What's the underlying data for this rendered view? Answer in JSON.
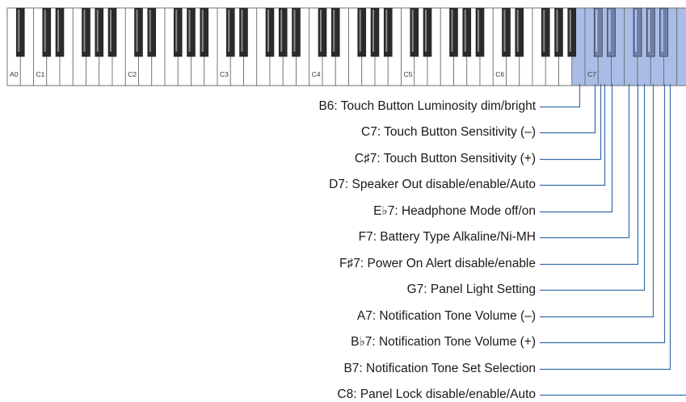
{
  "keyboard": {
    "white_key_color": "#ffffff",
    "highlight_color": "#a9bde6",
    "black_key_color": "#2b2b2b",
    "black_key_highlight_color": "#6e7fa8",
    "octave_labels": [
      "A0",
      "C1",
      "C2",
      "C3",
      "C4",
      "C5",
      "C6",
      "C7"
    ]
  },
  "leader_color": "#3a6ea8",
  "functions": [
    {
      "label": "B6: Touch Button Luminosity dim/bright",
      "key": "B6"
    },
    {
      "label": "C7: Touch Button Sensitivity (–)",
      "key": "C7"
    },
    {
      "label": "C♯7: Touch Button Sensitivity (+)",
      "key": "C#7"
    },
    {
      "label": "D7: Speaker Out disable/enable/Auto",
      "key": "D7"
    },
    {
      "label": "E♭7: Headphone Mode off/on",
      "key": "Eb7"
    },
    {
      "label": "F7: Battery Type Alkaline/Ni-MH",
      "key": "F7"
    },
    {
      "label": "F♯7: Power On Alert disable/enable",
      "key": "F#7"
    },
    {
      "label": "G7: Panel Light Setting",
      "key": "G7"
    },
    {
      "label": "A7: Notification Tone Volume (–)",
      "key": "A7"
    },
    {
      "label": "B♭7: Notification Tone Volume (+)",
      "key": "Bb7"
    },
    {
      "label": "B7: Notification Tone Set Selection",
      "key": "B7"
    },
    {
      "label": "C8: Panel Lock disable/enable/Auto",
      "key": "C8"
    }
  ]
}
